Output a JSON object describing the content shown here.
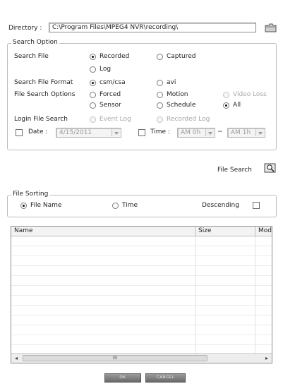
{
  "directory": {
    "label": "Directory :",
    "path": "C:\\Program Files\\MPEG4 NVR\\recording\\"
  },
  "search_option": {
    "legend": "Search Option",
    "search_file": {
      "label": "Search File",
      "recorded": "Recorded",
      "captured": "Captured",
      "log": "Log"
    },
    "format": {
      "label": "Search File Format",
      "csm": "csm/csa",
      "avi": "avi"
    },
    "file_search_options": {
      "label": "File Search Options",
      "forced": "Forced",
      "motion": "Motion",
      "video_loss": "Video Loss",
      "sensor": "Sensor",
      "schedule": "Schedule",
      "all": "All"
    },
    "login": {
      "label": "Login File Search",
      "event_log": "Event Log",
      "recorded_log": "Recorded Log"
    },
    "date": {
      "label": "Date :",
      "value": "4/15/2011"
    },
    "time": {
      "label": "Time :",
      "from": "AM 0h",
      "separator": "~",
      "to": "AM 1h"
    }
  },
  "file_search": {
    "label": "File Search"
  },
  "file_sorting": {
    "legend": "File Sorting",
    "file_name": "File Name",
    "time": "Time",
    "descending": "Descending"
  },
  "list": {
    "columns": [
      "Name",
      "Size",
      "Modif"
    ],
    "scroll_thumb_label": "III"
  },
  "buttons": {
    "ok": "OK",
    "cancel": "CANCEL"
  }
}
